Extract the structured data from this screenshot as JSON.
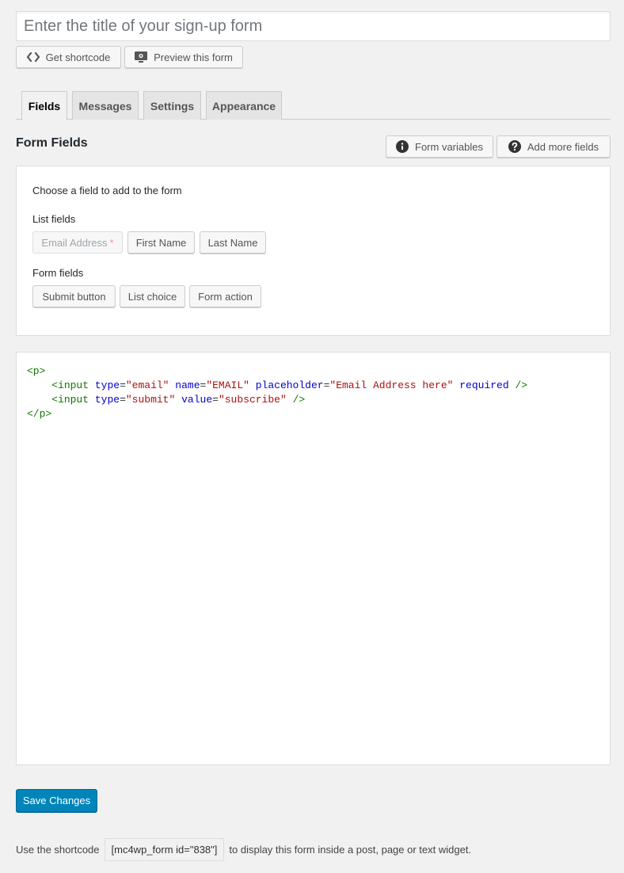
{
  "title_input": {
    "value": "",
    "placeholder": "Enter the title of your sign-up form"
  },
  "top_buttons": {
    "shortcode": "Get shortcode",
    "preview": "Preview this form"
  },
  "tabs": [
    {
      "label": "Fields",
      "active": true
    },
    {
      "label": "Messages",
      "active": false
    },
    {
      "label": "Settings",
      "active": false
    },
    {
      "label": "Appearance",
      "active": false
    }
  ],
  "section": {
    "title": "Form Fields",
    "form_variables": "Form variables",
    "add_more_fields": "Add more fields"
  },
  "chooser": {
    "heading": "Choose a field to add to the form",
    "list_fields_label": "List fields",
    "list_fields": [
      "Email Address",
      "First Name",
      "Last Name"
    ],
    "required_mark": "*",
    "form_fields_label": "Form fields",
    "form_fields": [
      "Submit button",
      "List choice",
      "Form action"
    ]
  },
  "code": {
    "p_open": "<p>",
    "p_close": "</p>",
    "line1": {
      "tag_open": "<input",
      "attr1": "type",
      "val1": "\"email\"",
      "attr2": "name",
      "val2": "\"EMAIL\"",
      "attr3": "placeholder",
      "val3": "\"Email Address here\"",
      "attr4": "required",
      "tag_close": "/>"
    },
    "line2": {
      "tag_open": "<input",
      "attr1": "type",
      "val1": "\"submit\"",
      "attr2": "value",
      "val2": "\"subscribe\"",
      "tag_close": "/>"
    }
  },
  "save_button": "Save Changes",
  "footer": {
    "before": "Use the shortcode",
    "shortcode": "[mc4wp_form id=\"838\"]",
    "after": "to display this form inside a post, page or text widget."
  },
  "colors": {
    "primary_button": "#0085ba",
    "tag": "#117700",
    "attribute": "#0000cc",
    "string": "#aa1111"
  },
  "icons": {
    "shortcode": "code-brackets-icon",
    "preview": "preview-screen-icon",
    "form_variables": "info-icon",
    "add_more_fields": "help-icon"
  }
}
